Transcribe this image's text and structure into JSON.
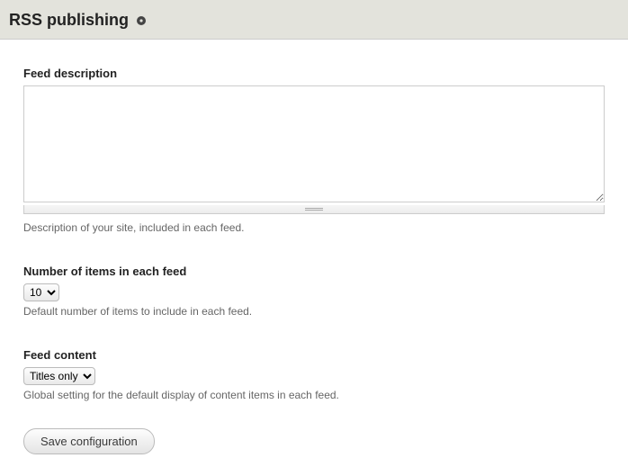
{
  "header": {
    "title": "RSS publishing"
  },
  "form": {
    "feed_description": {
      "label": "Feed description",
      "value": "",
      "help": "Description of your site, included in each feed."
    },
    "items_count": {
      "label": "Number of items in each feed",
      "selected": "10",
      "help": "Default number of items to include in each feed."
    },
    "feed_content": {
      "label": "Feed content",
      "selected": "Titles only",
      "help": "Global setting for the default display of content items in each feed."
    },
    "submit_label": "Save configuration"
  }
}
